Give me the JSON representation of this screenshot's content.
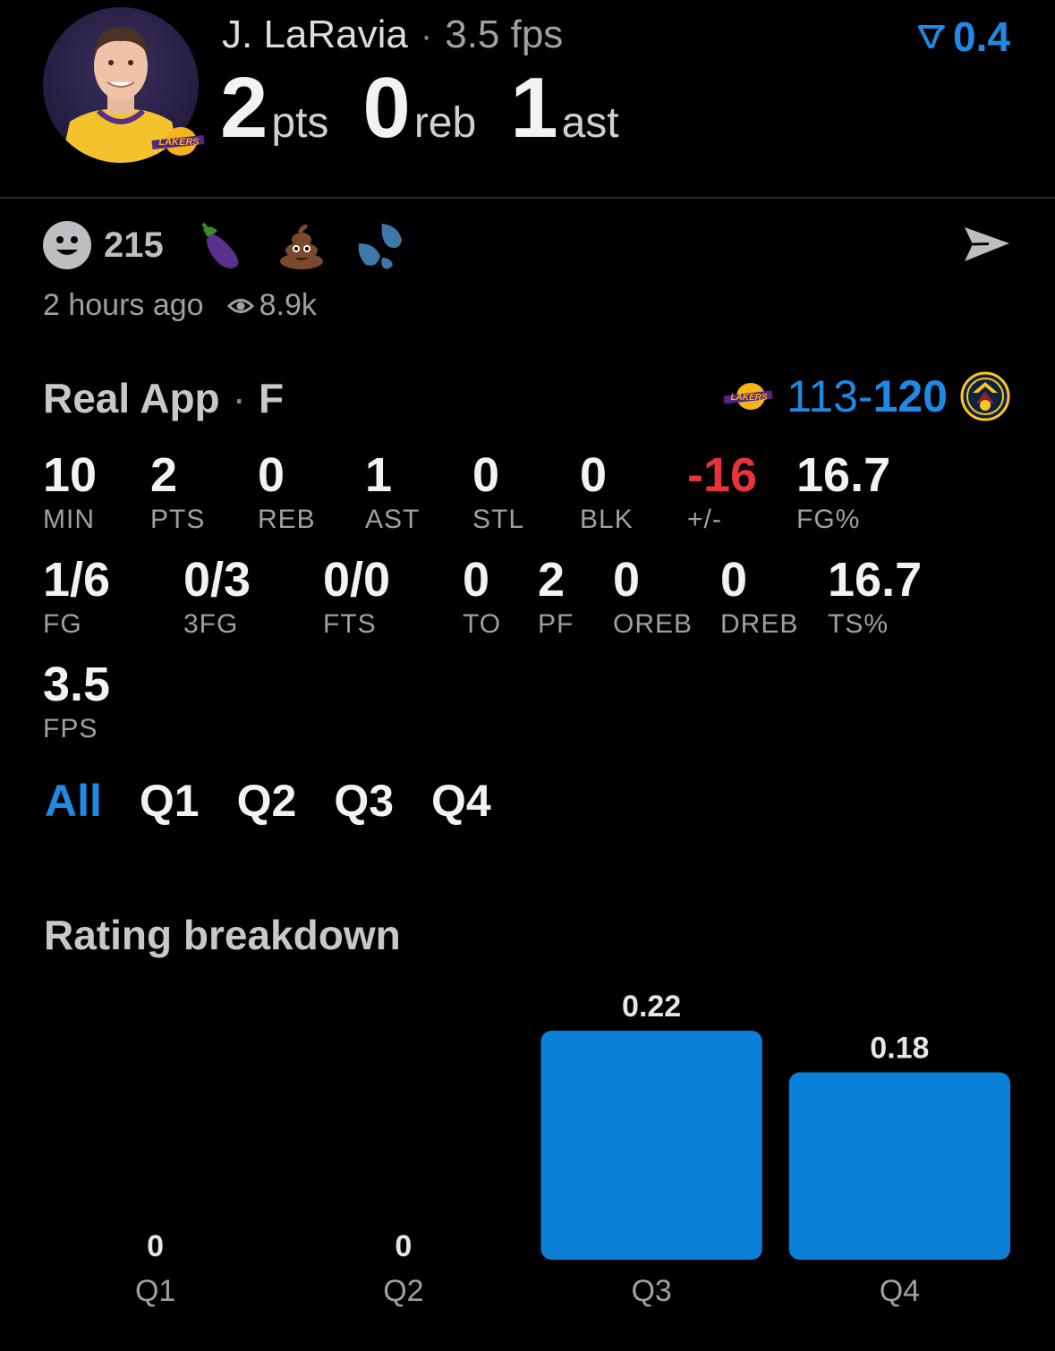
{
  "player": {
    "name": "J. LaRavia",
    "fps_label": "3.5 fps",
    "team_tag": "LAKERS",
    "stats": [
      {
        "value": "2",
        "unit": "pts"
      },
      {
        "value": "0",
        "unit": "reb"
      },
      {
        "value": "1",
        "unit": "ast"
      }
    ],
    "rating": "0.4"
  },
  "reactions": {
    "count": "215",
    "emojis": [
      "eggplant",
      "poop",
      "sweat-droplets"
    ],
    "time_ago": "2 hours ago",
    "views": "8.9k"
  },
  "game": {
    "source": "Real App",
    "status": "F",
    "score_away": "113",
    "score_sep": "-",
    "score_home": "120",
    "away_logo_text": "LAKERS"
  },
  "box_score": {
    "row1": [
      {
        "value": "10",
        "label": "MIN"
      },
      {
        "value": "2",
        "label": "PTS"
      },
      {
        "value": "0",
        "label": "REB"
      },
      {
        "value": "1",
        "label": "AST"
      },
      {
        "value": "0",
        "label": "STL"
      },
      {
        "value": "0",
        "label": "BLK"
      },
      {
        "value": "-16",
        "label": "+/-"
      },
      {
        "value": "16.7",
        "label": "FG%"
      }
    ],
    "row2": [
      {
        "value": "1/6",
        "label": "FG"
      },
      {
        "value": "0/3",
        "label": "3FG"
      },
      {
        "value": "0/0",
        "label": "FTS"
      },
      {
        "value": "0",
        "label": "TO"
      },
      {
        "value": "2",
        "label": "PF"
      },
      {
        "value": "0",
        "label": "OREB"
      },
      {
        "value": "0",
        "label": "DREB"
      },
      {
        "value": "16.7",
        "label": "TS%"
      }
    ],
    "row3": [
      {
        "value": "3.5",
        "label": "FPS"
      }
    ]
  },
  "tabs": [
    "All",
    "Q1",
    "Q2",
    "Q3",
    "Q4"
  ],
  "active_tab": "All",
  "colors": {
    "accent": "#1f8ae6",
    "negative": "#e8323c",
    "bar": "#0b80d9"
  },
  "chart_title": "Rating breakdown",
  "chart_data": {
    "type": "bar",
    "title": "Rating breakdown",
    "categories": [
      "Q1",
      "Q2",
      "Q3",
      "Q4"
    ],
    "values": [
      0,
      0,
      0.22,
      0.18
    ],
    "value_labels": [
      "0",
      "0",
      "0.22",
      "0.18"
    ],
    "xlabel": "",
    "ylabel": "",
    "grid": false
  }
}
